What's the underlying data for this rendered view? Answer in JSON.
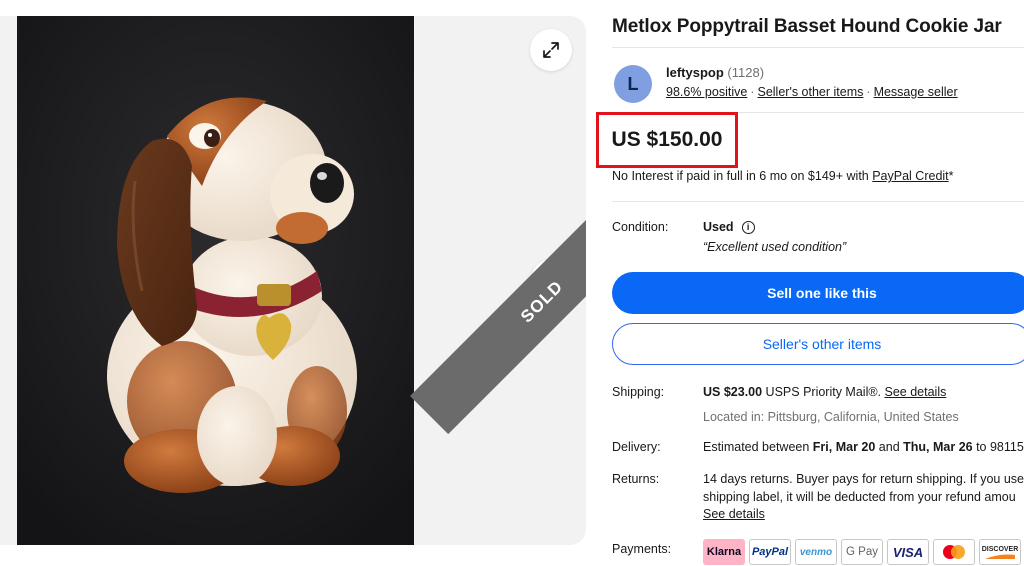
{
  "listing": {
    "title": "Metlox Poppytrail Basset Hound Cookie Jar",
    "sold_badge": "SOLD"
  },
  "seller": {
    "avatar_letter": "L",
    "name": "leftyspop",
    "feedback_count": "(1128)",
    "positive": "98.6% positive",
    "other_items_link": "Seller's other items",
    "message_link": "Message seller"
  },
  "price": {
    "amount": "US $150.00",
    "financing_prefix": "No Interest if paid in full in 6 mo on $149+ with ",
    "financing_link": "PayPal Credit",
    "financing_suffix": "*"
  },
  "details": {
    "condition_label": "Condition:",
    "condition_value": "Used",
    "condition_note": "“Excellent used condition”",
    "sell_like_button": "Sell one like this",
    "other_items_button": "Seller's other items",
    "shipping_label": "Shipping:",
    "shipping_price": "US $23.00",
    "shipping_method": " USPS Priority Mail®. ",
    "shipping_link": "See details",
    "location": "Located in: Pittsburg, California, United States",
    "delivery_label": "Delivery:",
    "delivery_prefix": "Estimated between ",
    "delivery_start": "Fri, Mar 20",
    "delivery_and": " and ",
    "delivery_end": "Thu, Mar 26",
    "delivery_suffix": " to 98115",
    "returns_label": "Returns:",
    "returns_line1": "14 days returns. Buyer pays for return shipping. If you use a",
    "returns_line2": "shipping label, it will be deducted from your refund amou",
    "returns_link": "See details",
    "payments_label": "Payments:"
  },
  "payments": [
    "Klarna",
    "PayPal",
    "venmo",
    "G Pay",
    "VISA",
    "",
    "DISCOVER"
  ],
  "colors": {
    "primary": "#0968f6",
    "price_highlight": "#e0121a",
    "avatar": "#7f9fe0"
  },
  "icons": {
    "expand": "expand-arrows-icon",
    "next": "chevron-right-icon",
    "info": "info-circle-icon"
  }
}
